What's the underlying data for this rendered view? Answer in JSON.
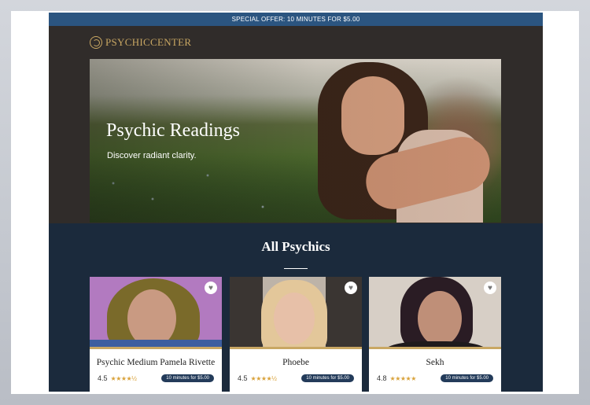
{
  "promo": {
    "text": "SPECIAL OFFER: 10 MINUTES FOR $5.00"
  },
  "brand": {
    "logo_text": "PSYCHICCENTER"
  },
  "hero": {
    "title": "Psychic Readings",
    "subtitle": "Discover radiant clarity."
  },
  "section": {
    "title": "All Psychics"
  },
  "cards": [
    {
      "name": "Psychic Medium Pamela Rivette",
      "rating": "4.5",
      "stars": "★★★★½",
      "offer": "10 minutes for $5.00"
    },
    {
      "name": "Phoebe",
      "rating": "4.5",
      "stars": "★★★★½",
      "offer": "10 minutes for $5.00"
    },
    {
      "name": "Sekh",
      "rating": "4.8",
      "stars": "★★★★★",
      "offer": "10 minutes for $5.00"
    }
  ],
  "colors": {
    "promo_bar": "#2b5580",
    "header_bg": "#302c2a",
    "brand_gold": "#c9a763",
    "section_bg": "#1b2a3c",
    "pill_bg": "#233b5a",
    "star": "#d9a23a"
  },
  "icons": {
    "favorite": "heart-icon",
    "logo": "logo-mark-icon"
  }
}
